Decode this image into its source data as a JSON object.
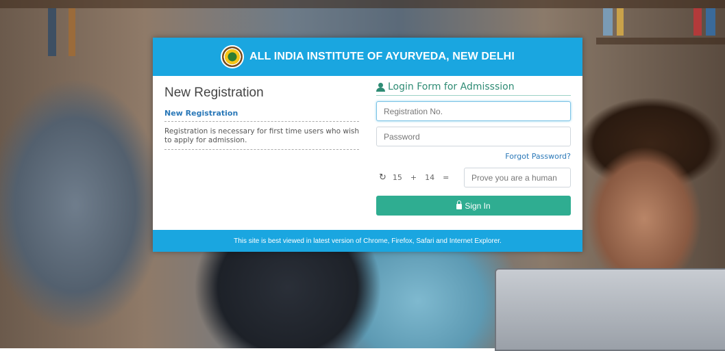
{
  "header": {
    "title": "ALL INDIA INSTITUTE OF AYURVEDA, NEW DELHI",
    "logo_icon": "aiia-emblem"
  },
  "registration": {
    "heading": "New Registration",
    "link_label": "New Registration",
    "description": "Registration is necessary for first time users who wish to apply for admission."
  },
  "login": {
    "title": "Login Form for Admisssion",
    "registration_placeholder": "Registration No.",
    "password_placeholder": "Password",
    "forgot_label": "Forgot Password?",
    "captcha": {
      "num1": "15",
      "op": "+",
      "num2": "14",
      "eq": "=",
      "answer_placeholder": "Prove you are a human"
    },
    "signin_label": "Sign In"
  },
  "footer": {
    "text": "This site is best viewed in latest version of Chrome, Firefox, Safari and Internet Explorer."
  },
  "colors": {
    "header_blue": "#1aa6e0",
    "accent_green": "#2fad91",
    "link_blue": "#2a78b8"
  }
}
